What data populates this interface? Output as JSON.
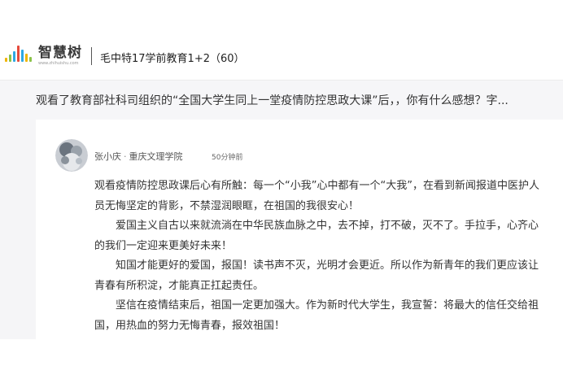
{
  "header": {
    "logo_text": "智慧树",
    "logo_url": "www.zhihuishu.com",
    "course_title": "毛中特17学前教育1+2（60）",
    "logo_bar_colors": [
      "#f0b400",
      "#8bc34a",
      "#2ea8e5",
      "#e64a3c",
      "#2ea8e5",
      "#f0b400",
      "#8bc34a"
    ]
  },
  "question": {
    "text": "观看了教育部社科司组织的“全国大学生同上一堂疫情防控思政大课”后，，你有什么感想？字..."
  },
  "answer": {
    "author_name": "张小庆",
    "separator": "·",
    "school": "重庆文理学院",
    "time": "50分钟前",
    "paragraphs": [
      "观看疫情防控思政课后心有所触：每一个“小我”心中都有一个“大我”，在看到新闻报道中医护人员无悔坚定的背影，不禁湿润眼眶，在祖国的我很安心！",
      "爱国主义自古以来就流淌在中华民族血脉之中，去不掉，打不破，灭不了。手拉手，心齐心的我们一定迎来更美好未来！",
      "知国才能更好的爱国，报国！读书声不灭，光明才会更近。所以作为新青年的我们更应该让青春有所积淀，才能真正扛起责任。",
      "坚信在疫情结束后，祖国一定更加强大。作为新时代大学生，我宣誓：将最大的信任交给祖国，用热血的努力无悔青春，报效祖国！"
    ]
  }
}
